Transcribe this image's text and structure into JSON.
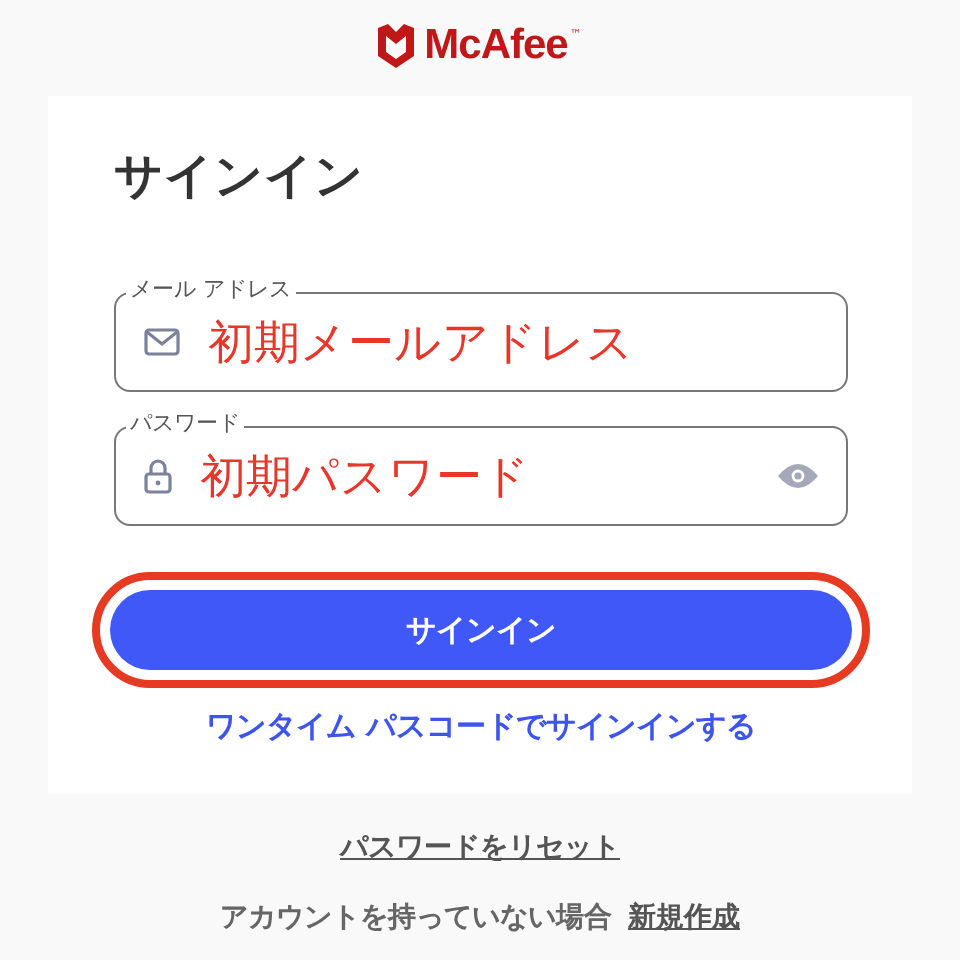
{
  "logo": {
    "name": "McAfee",
    "mark": "™"
  },
  "title": "サインイン",
  "fields": [
    {
      "kind": "email",
      "label": "メール アドレス",
      "value": "初期メールアドレス"
    },
    {
      "kind": "password",
      "label": "パスワード",
      "value": "初期パスワード"
    }
  ],
  "sign_in_button": {
    "label": "サインイン",
    "highlighted": true
  },
  "otp_link": "ワンタイム パスコードでサインインする",
  "reset_link": "パスワードをリセット",
  "signup": {
    "text": "アカウントを持っていない場合",
    "link": "新規作成"
  }
}
